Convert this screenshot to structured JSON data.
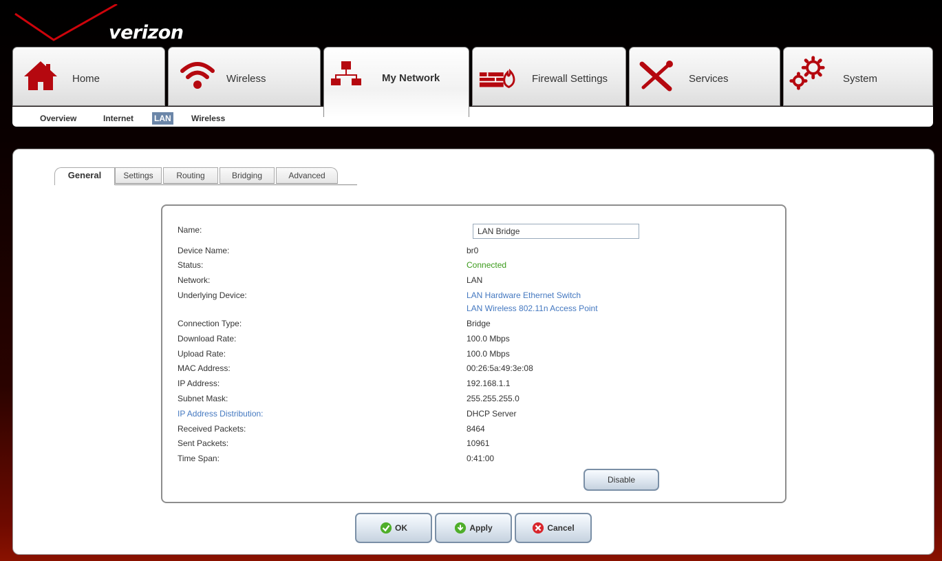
{
  "brand": {
    "logo_text": "verizon",
    "accent": "#cd040b"
  },
  "nav": {
    "tabs": [
      {
        "label": "Home",
        "icon": "home-icon"
      },
      {
        "label": "Wireless",
        "icon": "wifi-icon"
      },
      {
        "label": "My Network",
        "icon": "network-icon",
        "active": true
      },
      {
        "label": "Firewall Settings",
        "icon": "firewall-icon"
      },
      {
        "label": "Services",
        "icon": "tools-icon"
      },
      {
        "label": "System",
        "icon": "gears-icon"
      }
    ]
  },
  "subnav": {
    "items": [
      {
        "label": "Overview"
      },
      {
        "label": "Internet"
      },
      {
        "label": "LAN",
        "active": true
      },
      {
        "label": "Wireless"
      }
    ]
  },
  "subtabs": [
    {
      "label": "General",
      "active": true
    },
    {
      "label": "Settings"
    },
    {
      "label": "Routing"
    },
    {
      "label": "Bridging"
    },
    {
      "label": "Advanced"
    }
  ],
  "details": {
    "name_label": "Name:",
    "name_value": "LAN Bridge",
    "rows": [
      {
        "label": "Device Name:",
        "value": "br0"
      },
      {
        "label": "Status:",
        "value": "Connected",
        "color": "#3a9a1a"
      },
      {
        "label": "Network:",
        "value": "LAN"
      },
      {
        "label": "Underlying Device:",
        "value": "LAN Hardware Ethernet Switch",
        "value2": "LAN Wireless 802.11n Access Point",
        "link": true
      },
      {
        "label": "Connection Type:",
        "value": "Bridge"
      },
      {
        "label": "Download Rate:",
        "value": "100.0 Mbps"
      },
      {
        "label": "Upload Rate:",
        "value": "100.0 Mbps"
      },
      {
        "label": "MAC Address:",
        "value": "00:26:5a:49:3e:08"
      },
      {
        "label": "IP Address:",
        "value": "192.168.1.1"
      },
      {
        "label": "Subnet Mask:",
        "value": "255.255.255.0"
      },
      {
        "label": "IP Address Distribution:",
        "value": "DHCP Server",
        "label_link": true
      },
      {
        "label": "Received Packets:",
        "value": "8464"
      },
      {
        "label": "Sent Packets:",
        "value": "10961"
      },
      {
        "label": "Time Span:",
        "value": "0:41:00"
      }
    ],
    "disable_label": "Disable"
  },
  "actions": {
    "ok_label": "OK",
    "apply_label": "Apply",
    "cancel_label": "Cancel"
  }
}
